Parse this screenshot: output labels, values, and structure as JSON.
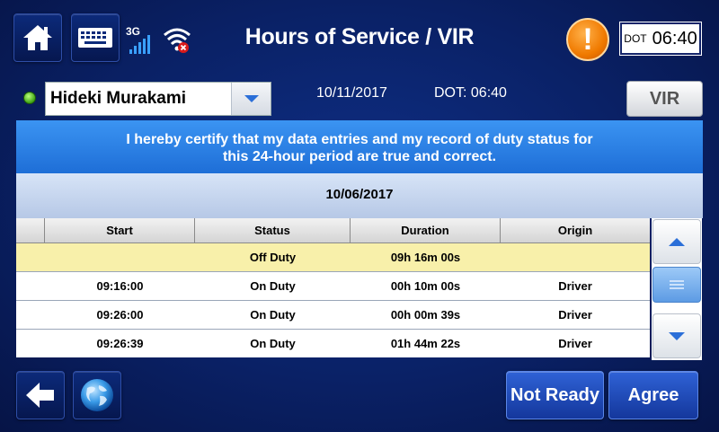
{
  "header": {
    "title": "Hours of Service / VIR",
    "network": "3G",
    "dot_label": "DOT",
    "dot_time": "06:40",
    "alert_symbol": "!"
  },
  "driver": {
    "name": "Hideki Murakami",
    "date": "10/11/2017",
    "dot_time_text": "DOT: 06:40",
    "vir_label": "VIR"
  },
  "certification": {
    "line1": "I hereby certify that my data entries and my record of duty status for",
    "line2": "this 24-hour period are true and correct."
  },
  "log": {
    "date": "10/06/2017",
    "columns": [
      "Start",
      "Status",
      "Duration",
      "Origin"
    ],
    "rows": [
      {
        "start": "",
        "status": "Off Duty",
        "duration": "09h 16m 00s",
        "origin": ""
      },
      {
        "start": "09:16:00",
        "status": "On Duty",
        "duration": "00h 10m 00s",
        "origin": "Driver"
      },
      {
        "start": "09:26:00",
        "status": "On Duty",
        "duration": "00h 00m 39s",
        "origin": "Driver"
      },
      {
        "start": "09:26:39",
        "status": "On Duty",
        "duration": "01h 44m 22s",
        "origin": "Driver"
      }
    ]
  },
  "actions": {
    "not_ready": "Not Ready",
    "agree": "Agree"
  },
  "colors": {
    "background": "#0a2166",
    "certify_banner": "#2f86ea",
    "selected_row": "#f8f0aa",
    "alert": "#f07a00",
    "status_led": "#3ea314"
  },
  "icons": {
    "home": "home-icon",
    "keyboard": "keyboard-icon",
    "signal": "signal-bars-icon",
    "wifi": "wifi-disconnected-icon",
    "alert": "alert-icon",
    "back": "back-arrow-icon",
    "globe": "globe-icon"
  }
}
